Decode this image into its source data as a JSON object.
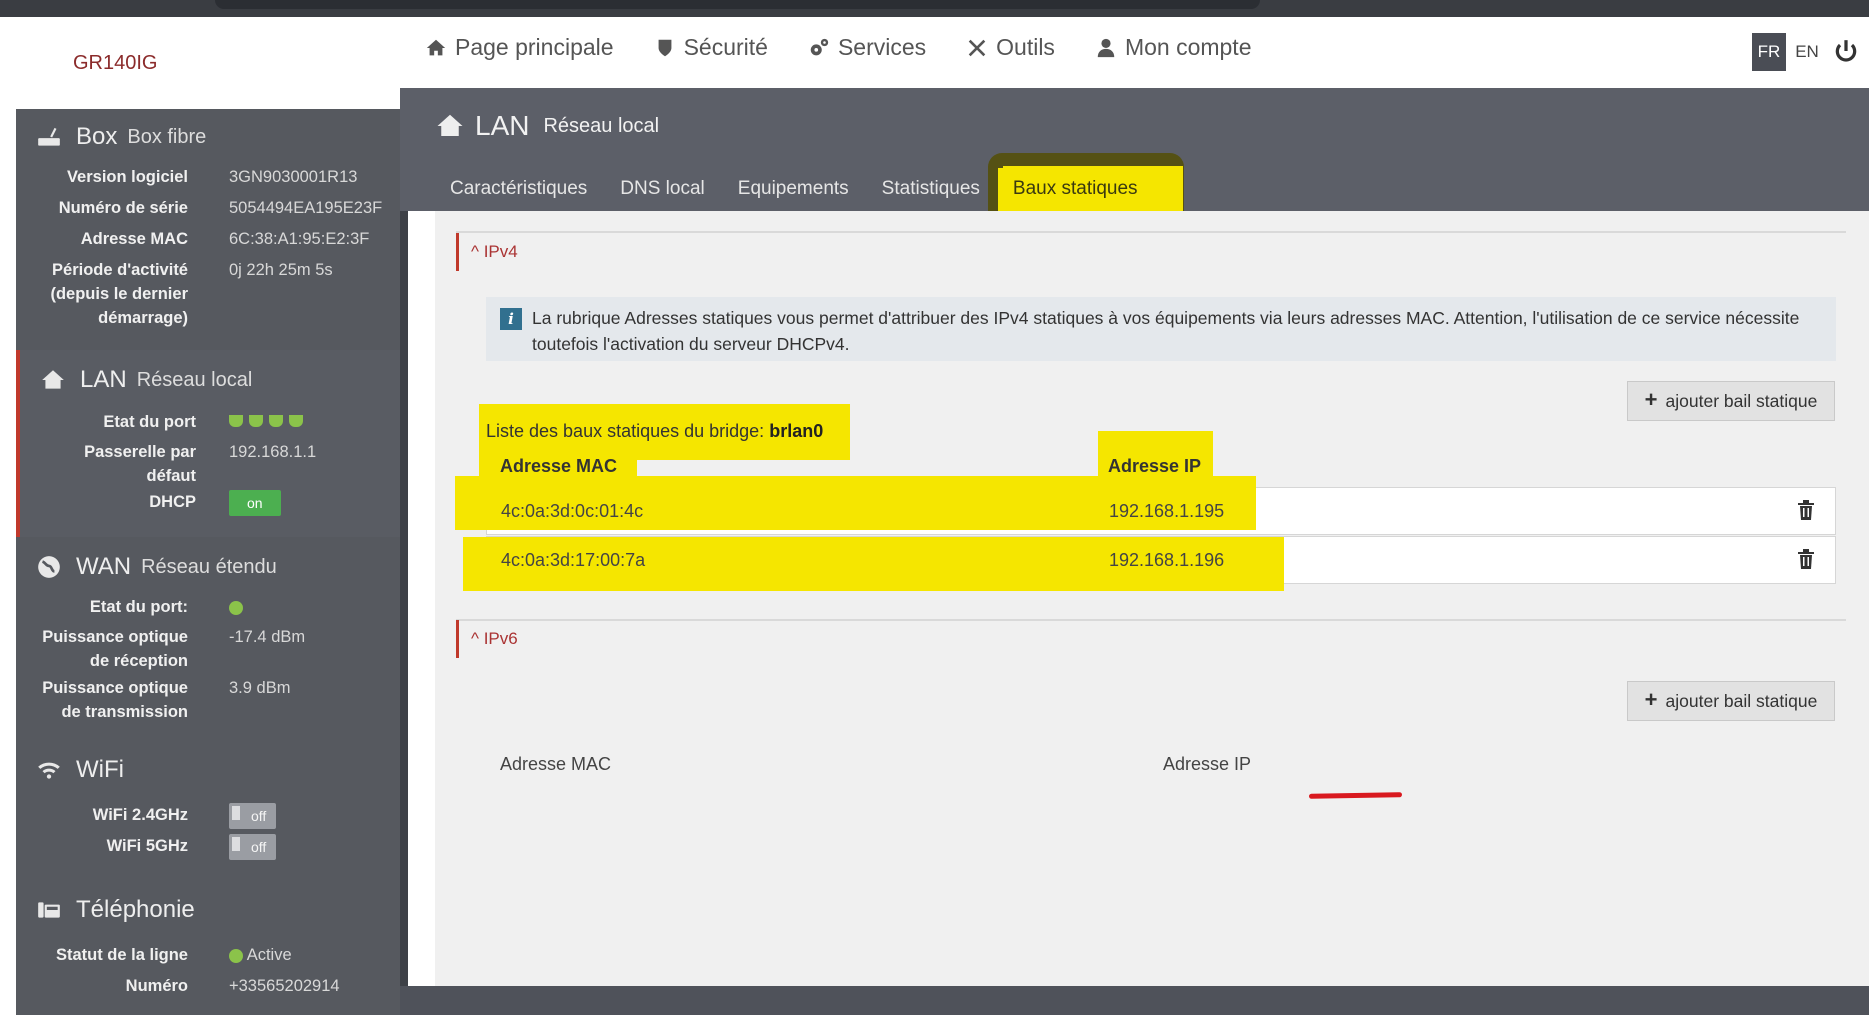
{
  "brand": "GR140IG",
  "topnav": [
    {
      "label": "Page principale",
      "icon": "home-icon"
    },
    {
      "label": "Sécurité",
      "icon": "shield-icon"
    },
    {
      "label": "Services",
      "icon": "gears-icon"
    },
    {
      "label": "Outils",
      "icon": "tools-icon"
    },
    {
      "label": "Mon compte",
      "icon": "user-icon"
    }
  ],
  "languages": {
    "fr": "FR",
    "en": "EN"
  },
  "sidebar": {
    "box": {
      "title": "Box",
      "subtitle": "Box fibre",
      "rows": [
        {
          "label": "Version logiciel",
          "value": "3GN9030001R13"
        },
        {
          "label": "Numéro de série",
          "value": "5054494EA195E23F"
        },
        {
          "label": "Adresse MAC",
          "value": "6C:38:A1:95:E2:3F"
        },
        {
          "label_lines": [
            "Période d'activité",
            "(depuis le dernier",
            "démarrage)"
          ],
          "value": "0j 22h 25m 5s"
        }
      ]
    },
    "lan": {
      "title": "LAN",
      "subtitle": "Réseau local",
      "port_label": "Etat du port",
      "gateway_label_lines": [
        "Passerelle par",
        "défaut"
      ],
      "gateway_value": "192.168.1.1",
      "dhcp_label": "DHCP",
      "dhcp_value": "on"
    },
    "wan": {
      "title": "WAN",
      "subtitle": "Réseau étendu",
      "port_label": "Etat du port:",
      "rx_label_lines": [
        "Puissance optique",
        "de réception"
      ],
      "rx_value": "-17.4 dBm",
      "tx_label_lines": [
        "Puissance optique",
        "de transmission"
      ],
      "tx_value": "3.9 dBm"
    },
    "wifi": {
      "title": "WiFi",
      "rows": [
        {
          "label": "WiFi 2.4GHz",
          "value": "off"
        },
        {
          "label": "WiFi 5GHz",
          "value": "off"
        }
      ]
    },
    "phone": {
      "title": "Téléphonie",
      "status_label": "Statut de la ligne",
      "status_value": "Active",
      "number_label": "Numéro",
      "number_value": "+33565202914"
    }
  },
  "main": {
    "title": "LAN",
    "subtitle": "Réseau local",
    "tabs": [
      "Caractéristiques",
      "DNS local",
      "Equipements",
      "Statistiques",
      "Baux statiques"
    ],
    "active_tab": "Baux statiques",
    "ipv4": {
      "toggle": "IPv4",
      "info": "La rubrique Adresses statiques vous permet d'attribuer des IPv4 statiques à vos équipements via leurs adresses MAC. Attention, l'utilisation de ce service nécessite toutefois l'activation du serveur DHCPv4.",
      "add_button": "ajouter bail statique",
      "bridge_prefix": "Liste des baux statiques du bridge:",
      "bridge_name": "brlan0",
      "col_mac": "Adresse MAC",
      "col_ip": "Adresse IP",
      "rows": [
        {
          "mac": "4c:0a:3d:0c:01:4c",
          "ip": "192.168.1.195"
        },
        {
          "mac": "4c:0a:3d:17:00:7a",
          "ip": "192.168.1.196"
        }
      ]
    },
    "ipv6": {
      "toggle": "IPv6",
      "add_button": "ajouter bail statique",
      "col_mac": "Adresse MAC",
      "col_ip": "Adresse IP"
    }
  },
  "colors": {
    "accent_red": "#c0392b",
    "highlight": "#f5e600",
    "status_green": "#8bc34a",
    "sidebar_bg": "#4f525a"
  }
}
